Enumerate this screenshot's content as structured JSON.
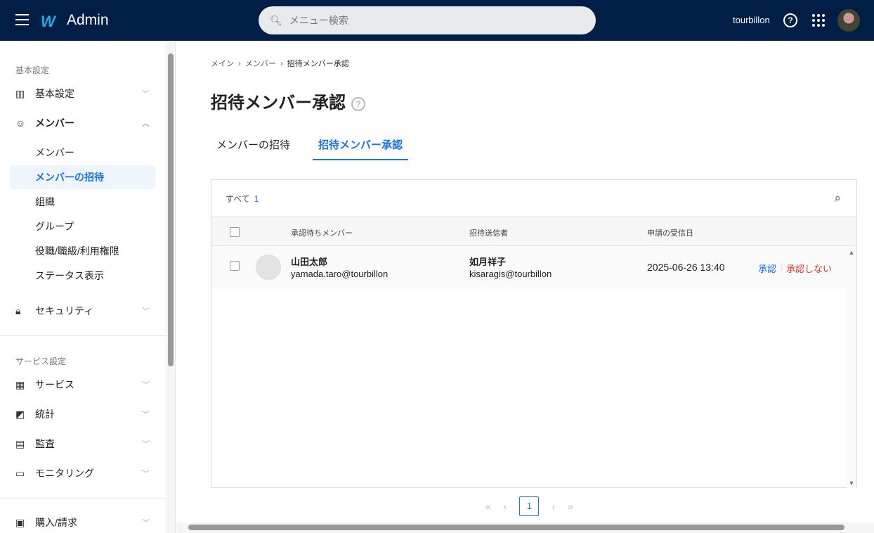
{
  "header": {
    "app_title": "Admin",
    "search_placeholder": "メニュー検索",
    "username": "tourbillon"
  },
  "sidebar": {
    "section1": "基本設定",
    "items": [
      {
        "label": "基本設定"
      },
      {
        "label": "メンバー"
      },
      {
        "label": "セキュリティ"
      }
    ],
    "subitems": [
      {
        "label": "メンバー"
      },
      {
        "label": "メンバーの招待"
      },
      {
        "label": "組織"
      },
      {
        "label": "グループ"
      },
      {
        "label": "役職/職級/利用権限"
      },
      {
        "label": "ステータス表示"
      }
    ],
    "section2": "サービス設定",
    "items2": [
      {
        "label": "サービス"
      },
      {
        "label": "統計"
      },
      {
        "label": "監査"
      },
      {
        "label": "モニタリング"
      },
      {
        "label": "購入/請求"
      }
    ]
  },
  "breadcrumb": [
    "メイン",
    "メンバー",
    "招待メンバー承認"
  ],
  "page_title": "招待メンバー承認",
  "tabs": [
    {
      "label": "メンバーの招待"
    },
    {
      "label": "招待メンバー承認"
    }
  ],
  "filter": {
    "label": "すべて",
    "count": "1"
  },
  "table": {
    "headers": [
      "承認待ちメンバー",
      "招待送信者",
      "申請の受信日"
    ],
    "rows": [
      {
        "name": "山田太郎",
        "email": "yamada.taro@tourbillon",
        "sender_name": "如月祥子",
        "sender_email": "kisaragis@tourbillon",
        "date": "2025-06-26 13:40",
        "approve": "承認",
        "reject": "承認しない"
      }
    ]
  },
  "pagination": {
    "current": "1"
  }
}
